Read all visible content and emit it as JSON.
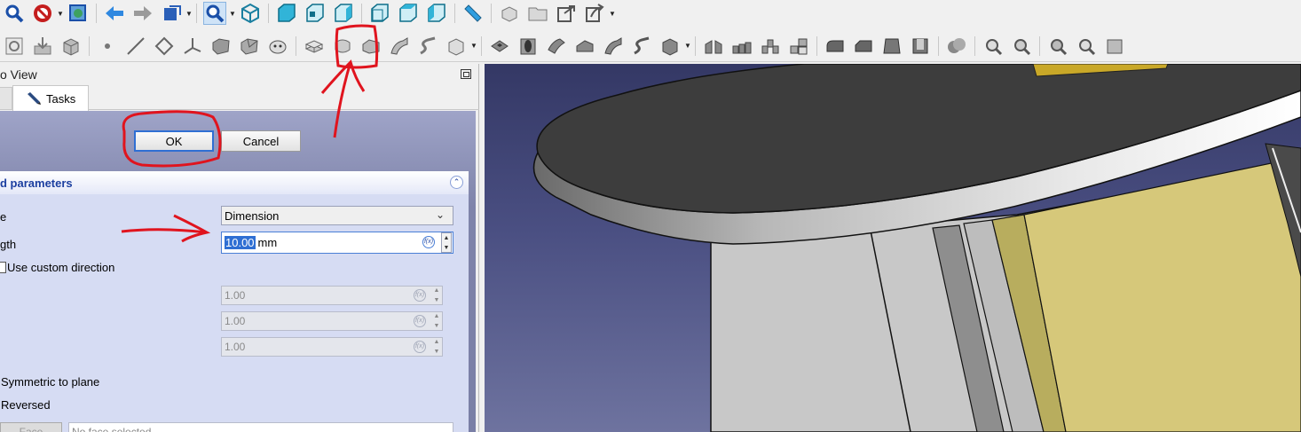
{
  "combo_view": {
    "title": "o View",
    "tabs": [
      {
        "label": ""
      },
      {
        "label": "Tasks"
      }
    ]
  },
  "task_buttons": {
    "ok_label": "OK",
    "cancel_label": "Cancel"
  },
  "parameters": {
    "title": "d parameters",
    "type_label": "e",
    "type_value": "Dimension",
    "length_label": "gth",
    "length_value": "10.00",
    "length_unit": "mm",
    "use_custom_direction_label": "Use custom direction",
    "direction_x": "1.00",
    "direction_y": "1.00",
    "direction_z": "1.00",
    "symmetric_label": "Symmetric to plane",
    "reversed_label": "Reversed",
    "face_button_label": "Face",
    "face_field_value": "No face selected"
  },
  "colors": {
    "accent": "#2f6fd3",
    "annotation": "#e0141e",
    "panel_title": "#1c3fa0",
    "part_yellow": "#d6c87a",
    "part_dark": "#3d3d3d"
  },
  "toolbar_icons": {
    "row1": [
      "fit-all-icon",
      "draw-style-icon",
      "bounding-box-icon",
      "back-icon",
      "forward-icon",
      "workbench-icon",
      "zoom-icon",
      "isometric-icon",
      "front-view-icon",
      "top-view-icon",
      "right-view-icon",
      "rear-view-icon",
      "bottom-view-icon",
      "left-view-icon",
      "measure-icon",
      "create-body-icon",
      "create-part-icon",
      "link-icon",
      "export-icon"
    ],
    "row2": [
      "sketch-icon",
      "attach-sketch-icon",
      "clone-icon",
      "datum-point-icon",
      "datum-line-icon",
      "datum-plane-icon",
      "local-cs-icon",
      "shape-binder-icon",
      "subshape-binder-icon",
      "sheep-clone-icon",
      "pad-icon",
      "revolution-icon",
      "additive-loft-icon",
      "additive-pipe-icon",
      "additive-helix-icon",
      "additive-primitive-icon",
      "pocket-icon",
      "hole-icon",
      "groove-icon",
      "subtractive-loft-icon",
      "subtractive-pipe-icon",
      "subtractive-helix-icon",
      "subtractive-primitive-icon",
      "mirrored-icon",
      "linear-pattern-icon",
      "polar-pattern-icon",
      "multitransform-icon",
      "fillet-icon",
      "chamfer-icon",
      "draft-icon",
      "thickness-icon",
      "boolean-icon",
      "sprocket-icon",
      "involute-gear-icon",
      "shaft-wizard-icon",
      "check-geometry-icon",
      "defeaturing-icon"
    ]
  }
}
